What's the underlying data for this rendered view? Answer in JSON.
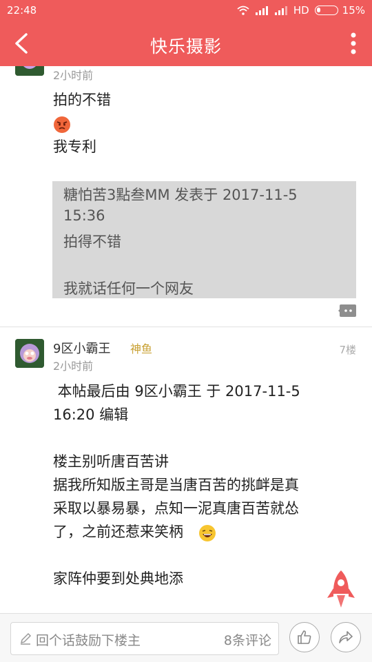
{
  "status_bar": {
    "time": "22:48",
    "network": "HD",
    "battery": "15%"
  },
  "header": {
    "title": "快乐摄影"
  },
  "post1": {
    "time": "2小时前",
    "lines": [
      "拍的不错",
      "我专利"
    ],
    "quote": {
      "lines": [
        "糖怕苦3點叁MM 发表于 2017-11-5",
        "15:36",
        "拍得不错",
        "",
        "我就话任何一个网友"
      ]
    }
  },
  "post2": {
    "username": "9区小霸王",
    "badge": "神鱼",
    "floor": "7楼",
    "time": "2小时前",
    "edit_line1": " 本帖最后由 9区小霸王 于 2017-11-5",
    "edit_line2": "16:20 编辑",
    "lines": [
      "楼主别听唐百苦讲",
      "据我所知版主哥是当唐百苦的挑衅是真",
      "采取以暴易暴，点知一泥真唐百苦就怂",
      "了，之前还惹来笑柄",
      "",
      "家阵仲要到处典地添"
    ]
  },
  "bottom_bar": {
    "reply_placeholder": "回个话鼓励下楼主",
    "comment_count": "8条评论"
  },
  "colors": {
    "accent": "#ef5b5b",
    "badge": "#c8a032"
  }
}
